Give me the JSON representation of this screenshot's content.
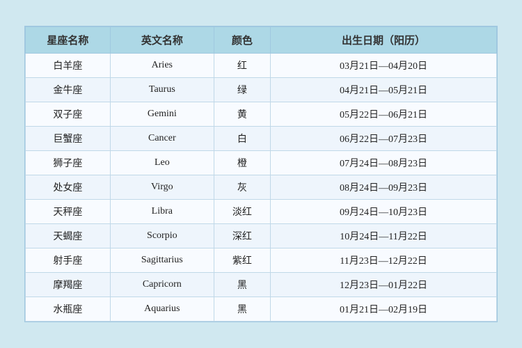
{
  "table": {
    "headers": [
      "星座名称",
      "英文名称",
      "颜色",
      "出生日期（阳历）"
    ],
    "rows": [
      {
        "chinese": "白羊座",
        "english": "Aries",
        "color": "红",
        "date": "03月21日—04月20日"
      },
      {
        "chinese": "金牛座",
        "english": "Taurus",
        "color": "绿",
        "date": "04月21日—05月21日"
      },
      {
        "chinese": "双子座",
        "english": "Gemini",
        "color": "黄",
        "date": "05月22日—06月21日"
      },
      {
        "chinese": "巨蟹座",
        "english": "Cancer",
        "color": "白",
        "date": "06月22日—07月23日"
      },
      {
        "chinese": "狮子座",
        "english": "Leo",
        "color": "橙",
        "date": "07月24日—08月23日"
      },
      {
        "chinese": "处女座",
        "english": "Virgo",
        "color": "灰",
        "date": "08月24日—09月23日"
      },
      {
        "chinese": "天秤座",
        "english": "Libra",
        "color": "淡红",
        "date": "09月24日—10月23日"
      },
      {
        "chinese": "天蝎座",
        "english": "Scorpio",
        "color": "深红",
        "date": "10月24日—11月22日"
      },
      {
        "chinese": "射手座",
        "english": "Sagittarius",
        "color": "紫红",
        "date": "11月23日—12月22日"
      },
      {
        "chinese": "摩羯座",
        "english": "Capricorn",
        "color": "黑",
        "date": "12月23日—01月22日"
      },
      {
        "chinese": "水瓶座",
        "english": "Aquarius",
        "color": "黑",
        "date": "01月21日—02月19日"
      }
    ]
  }
}
